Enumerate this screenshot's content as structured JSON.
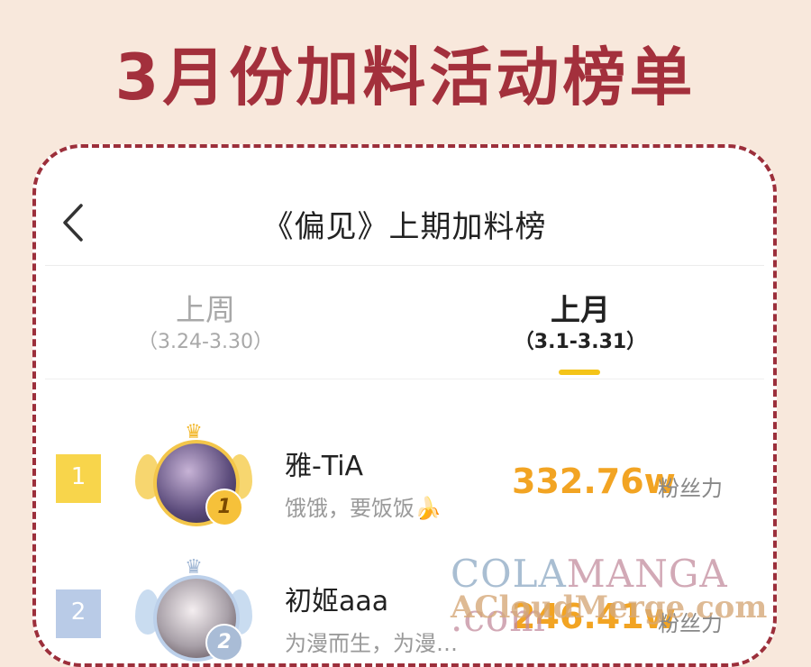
{
  "banner": {
    "title": "3月份加料活动榜单"
  },
  "header": {
    "back_icon": "chevron-left-icon",
    "title": "《偏见》上期加料榜"
  },
  "tabs": [
    {
      "label": "上周",
      "range": "（3.24-3.30）",
      "active": false
    },
    {
      "label": "上月",
      "range": "（3.1-3.31）",
      "active": true
    }
  ],
  "ranking": [
    {
      "rank": "1",
      "medal": "1",
      "name": "雅-TiA",
      "bio": "饿饿，要饭饭🍌",
      "score": "332.76w",
      "score_unit": "粉丝力"
    },
    {
      "rank": "2",
      "medal": "2",
      "name": "初姬aaa",
      "bio": "为漫而生，为漫…",
      "score": "246.41w",
      "score_unit": "粉丝力"
    }
  ],
  "watermark": {
    "line1_a": "COLA",
    "line1_b": "MANGA",
    "line1_c": ".com",
    "line2": "ACloudMerge.com"
  },
  "colors": {
    "accent_red": "#a3303c",
    "gold": "#f2a423",
    "underline": "#f4c419",
    "bg": "#f8e8dc"
  }
}
